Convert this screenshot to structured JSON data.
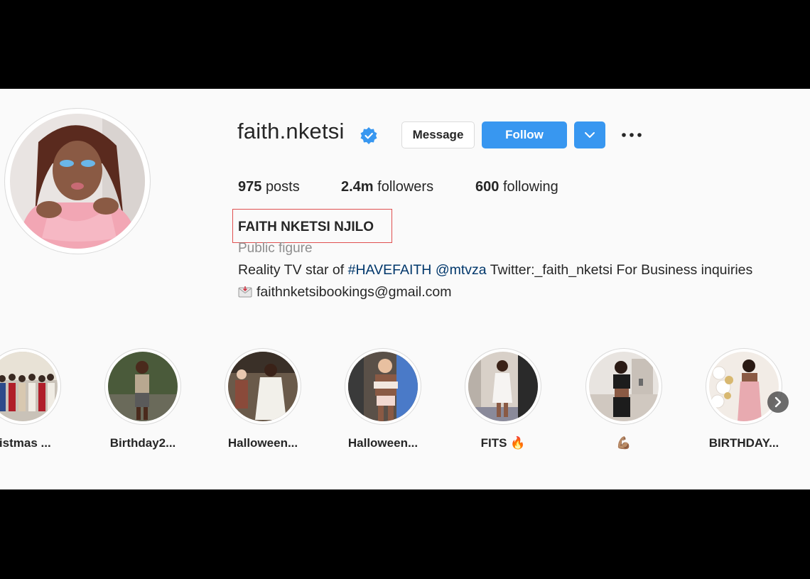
{
  "profile": {
    "username": "faith.nketsi",
    "full_name": "FAITH NKETSI NJILO",
    "category": "Public figure",
    "bio_prefix": "Reality TV star of ",
    "bio_hashtag": "#HAVEFAITH",
    "bio_mention": "@mtvza",
    "bio_suffix": " Twitter:_faith_nketsi For Business inquiries",
    "bio_email": "faithnketsibookings@gmail.com"
  },
  "actions": {
    "message_label": "Message",
    "follow_label": "Follow"
  },
  "stats": {
    "posts_value": "975",
    "posts_label": "posts",
    "followers_value": "2.4m",
    "followers_label": "followers",
    "following_value": "600",
    "following_label": "following"
  },
  "highlights": [
    {
      "label": "ristmas ..."
    },
    {
      "label": "Birthday2..."
    },
    {
      "label": "Halloween..."
    },
    {
      "label": "Halloween..."
    },
    {
      "label": "FITS 🔥"
    },
    {
      "label": "💪🏽"
    },
    {
      "label": "BIRTHDAY..."
    }
  ],
  "colors": {
    "accent": "#3897f0",
    "highlight_box": "#e05050",
    "link": "#00376b"
  }
}
